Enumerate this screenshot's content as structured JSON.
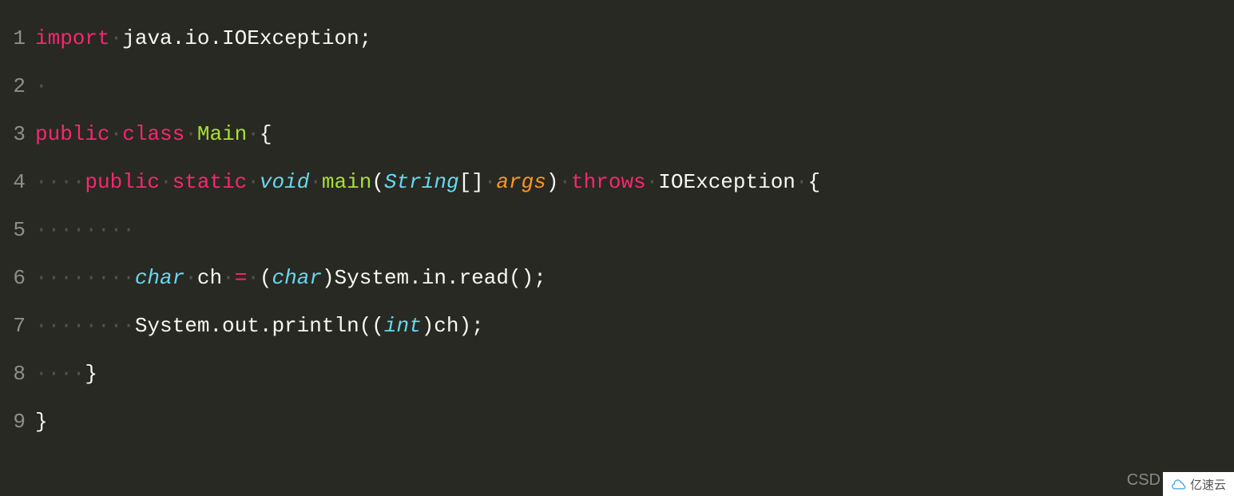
{
  "lines": [
    {
      "num": "1",
      "tokens": [
        {
          "cls": "kw-pink",
          "t": "import"
        },
        {
          "cls": "ws",
          "t": "·"
        },
        {
          "cls": "default",
          "t": "java.io.IOException;"
        }
      ]
    },
    {
      "num": "2",
      "tokens": [
        {
          "cls": "ws",
          "t": "·"
        }
      ]
    },
    {
      "num": "3",
      "tokens": [
        {
          "cls": "kw-pink",
          "t": "public"
        },
        {
          "cls": "ws",
          "t": "·"
        },
        {
          "cls": "kw-pink",
          "t": "class"
        },
        {
          "cls": "ws",
          "t": "·"
        },
        {
          "cls": "cls-name",
          "t": "Main"
        },
        {
          "cls": "ws",
          "t": "·"
        },
        {
          "cls": "punct",
          "t": "{"
        }
      ]
    },
    {
      "num": "4",
      "tokens": [
        {
          "cls": "ws",
          "t": "····"
        },
        {
          "cls": "kw-pink",
          "t": "public"
        },
        {
          "cls": "ws",
          "t": "·"
        },
        {
          "cls": "kw-pink",
          "t": "static"
        },
        {
          "cls": "ws",
          "t": "·"
        },
        {
          "cls": "kw-type",
          "t": "void"
        },
        {
          "cls": "ws",
          "t": "·"
        },
        {
          "cls": "cls-name",
          "t": "main"
        },
        {
          "cls": "punct",
          "t": "("
        },
        {
          "cls": "kw-type",
          "t": "String"
        },
        {
          "cls": "punct",
          "t": "[]"
        },
        {
          "cls": "ws",
          "t": "·"
        },
        {
          "cls": "param",
          "t": "args"
        },
        {
          "cls": "punct",
          "t": ")"
        },
        {
          "cls": "ws",
          "t": "·"
        },
        {
          "cls": "kw-pink",
          "t": "throws"
        },
        {
          "cls": "ws",
          "t": "·"
        },
        {
          "cls": "default",
          "t": "IOException"
        },
        {
          "cls": "ws",
          "t": "·"
        },
        {
          "cls": "punct",
          "t": "{"
        }
      ]
    },
    {
      "num": "5",
      "tokens": [
        {
          "cls": "ws",
          "t": "········"
        }
      ]
    },
    {
      "num": "6",
      "tokens": [
        {
          "cls": "ws",
          "t": "········"
        },
        {
          "cls": "kw-type",
          "t": "char"
        },
        {
          "cls": "ws",
          "t": "·"
        },
        {
          "cls": "default",
          "t": "ch"
        },
        {
          "cls": "ws",
          "t": "·"
        },
        {
          "cls": "kw-pink",
          "t": "="
        },
        {
          "cls": "ws",
          "t": "·"
        },
        {
          "cls": "punct",
          "t": "("
        },
        {
          "cls": "kw-type",
          "t": "char"
        },
        {
          "cls": "punct",
          "t": ")"
        },
        {
          "cls": "default",
          "t": "System.in.read();"
        }
      ]
    },
    {
      "num": "7",
      "tokens": [
        {
          "cls": "ws",
          "t": "········"
        },
        {
          "cls": "default",
          "t": "System.out.println(("
        },
        {
          "cls": "kw-type",
          "t": "int"
        },
        {
          "cls": "default",
          "t": ")ch);"
        }
      ]
    },
    {
      "num": "8",
      "tokens": [
        {
          "cls": "ws",
          "t": "····"
        },
        {
          "cls": "punct",
          "t": "}"
        }
      ]
    },
    {
      "num": "9",
      "tokens": [
        {
          "cls": "punct",
          "t": "}"
        }
      ]
    }
  ],
  "watermark_csd": "CSD",
  "watermark_box": "亿速云"
}
